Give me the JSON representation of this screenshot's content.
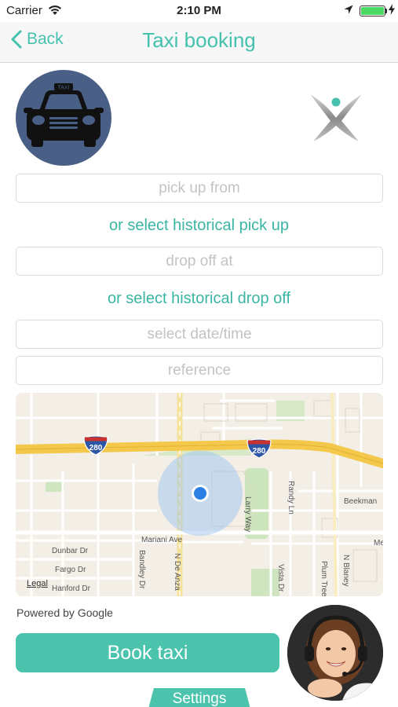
{
  "status_bar": {
    "carrier": "Carrier",
    "time": "2:10 PM"
  },
  "nav": {
    "back_label": "Back",
    "title": "Taxi booking"
  },
  "form": {
    "pickup_placeholder": "pick up from",
    "historical_pickup_link": "or select historical pick up",
    "dropoff_placeholder": "drop off at",
    "historical_dropoff_link": "or select historical drop off",
    "datetime_placeholder": "select date/time",
    "reference_placeholder": "reference"
  },
  "taxi_logo": {
    "sign_text": "TAXI"
  },
  "map": {
    "highway_shields": [
      "280",
      "280"
    ],
    "street_labels": {
      "beekman": "Beekman",
      "larry_way": "Larry Way",
      "randy_ln": "Randy Ln",
      "mariani_ave": "Mariani Ave",
      "dunbar_dr": "Dunbar Dr",
      "fargo_dr": "Fargo Dr",
      "hanford_dr": "Hanford Dr",
      "bandley_dr": "Bandley Dr",
      "n_de_anza": "N De Anza",
      "vista_dr": "Vista Dr",
      "plum_tree": "Plum Tree",
      "n_blaney": "N Blaney",
      "me": "Me"
    },
    "legal": "Legal"
  },
  "powered_by": "Powered by Google",
  "book_button": "Book taxi",
  "settings_tab": "Settings",
  "colors": {
    "accent": "#45c1ae",
    "button": "#4cc3ad",
    "taxi_circle": "#4a5f85",
    "highway": "#f3c84b",
    "location_dot": "#2c7fe3"
  }
}
